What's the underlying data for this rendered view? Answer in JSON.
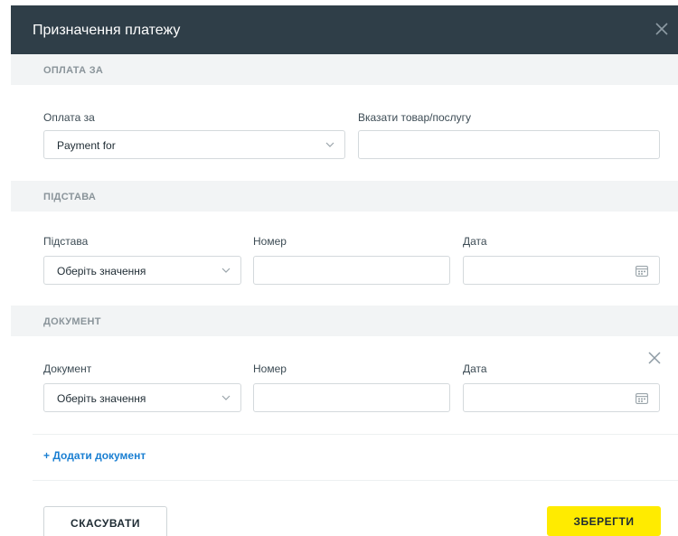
{
  "dialog": {
    "title": "Призначення платежу"
  },
  "payment_section": {
    "heading": "ОПЛАТА ЗА",
    "payment_for_label": "Оплата за",
    "payment_for_value": "Payment for",
    "goods_label": "Вказати товар/послугу",
    "goods_value": ""
  },
  "basis_section": {
    "heading": "ПІДСТАВА",
    "basis_label": "Підстава",
    "basis_value": "Оберіть значення",
    "number_label": "Номер",
    "number_value": "",
    "date_label": "Дата",
    "date_value": ""
  },
  "document_section": {
    "heading": "ДОКУМЕНТ",
    "document_label": "Документ",
    "document_value": "Оберіть значення",
    "number_label": "Номер",
    "number_value": "",
    "date_label": "Дата",
    "date_value": "",
    "add_document": "+ Додати документ"
  },
  "footer": {
    "cancel_label": "СКАСУВАТИ",
    "save_label": "ЗБЕРЕГТИ"
  },
  "colors": {
    "header_bg": "#2f3e48",
    "section_bg": "#f2f4f5",
    "accent_yellow": "#ffeb00",
    "link_blue": "#1a7fd2"
  },
  "icons": [
    "close-icon",
    "chevron-down-icon",
    "calendar-icon",
    "remove-document-icon"
  ]
}
